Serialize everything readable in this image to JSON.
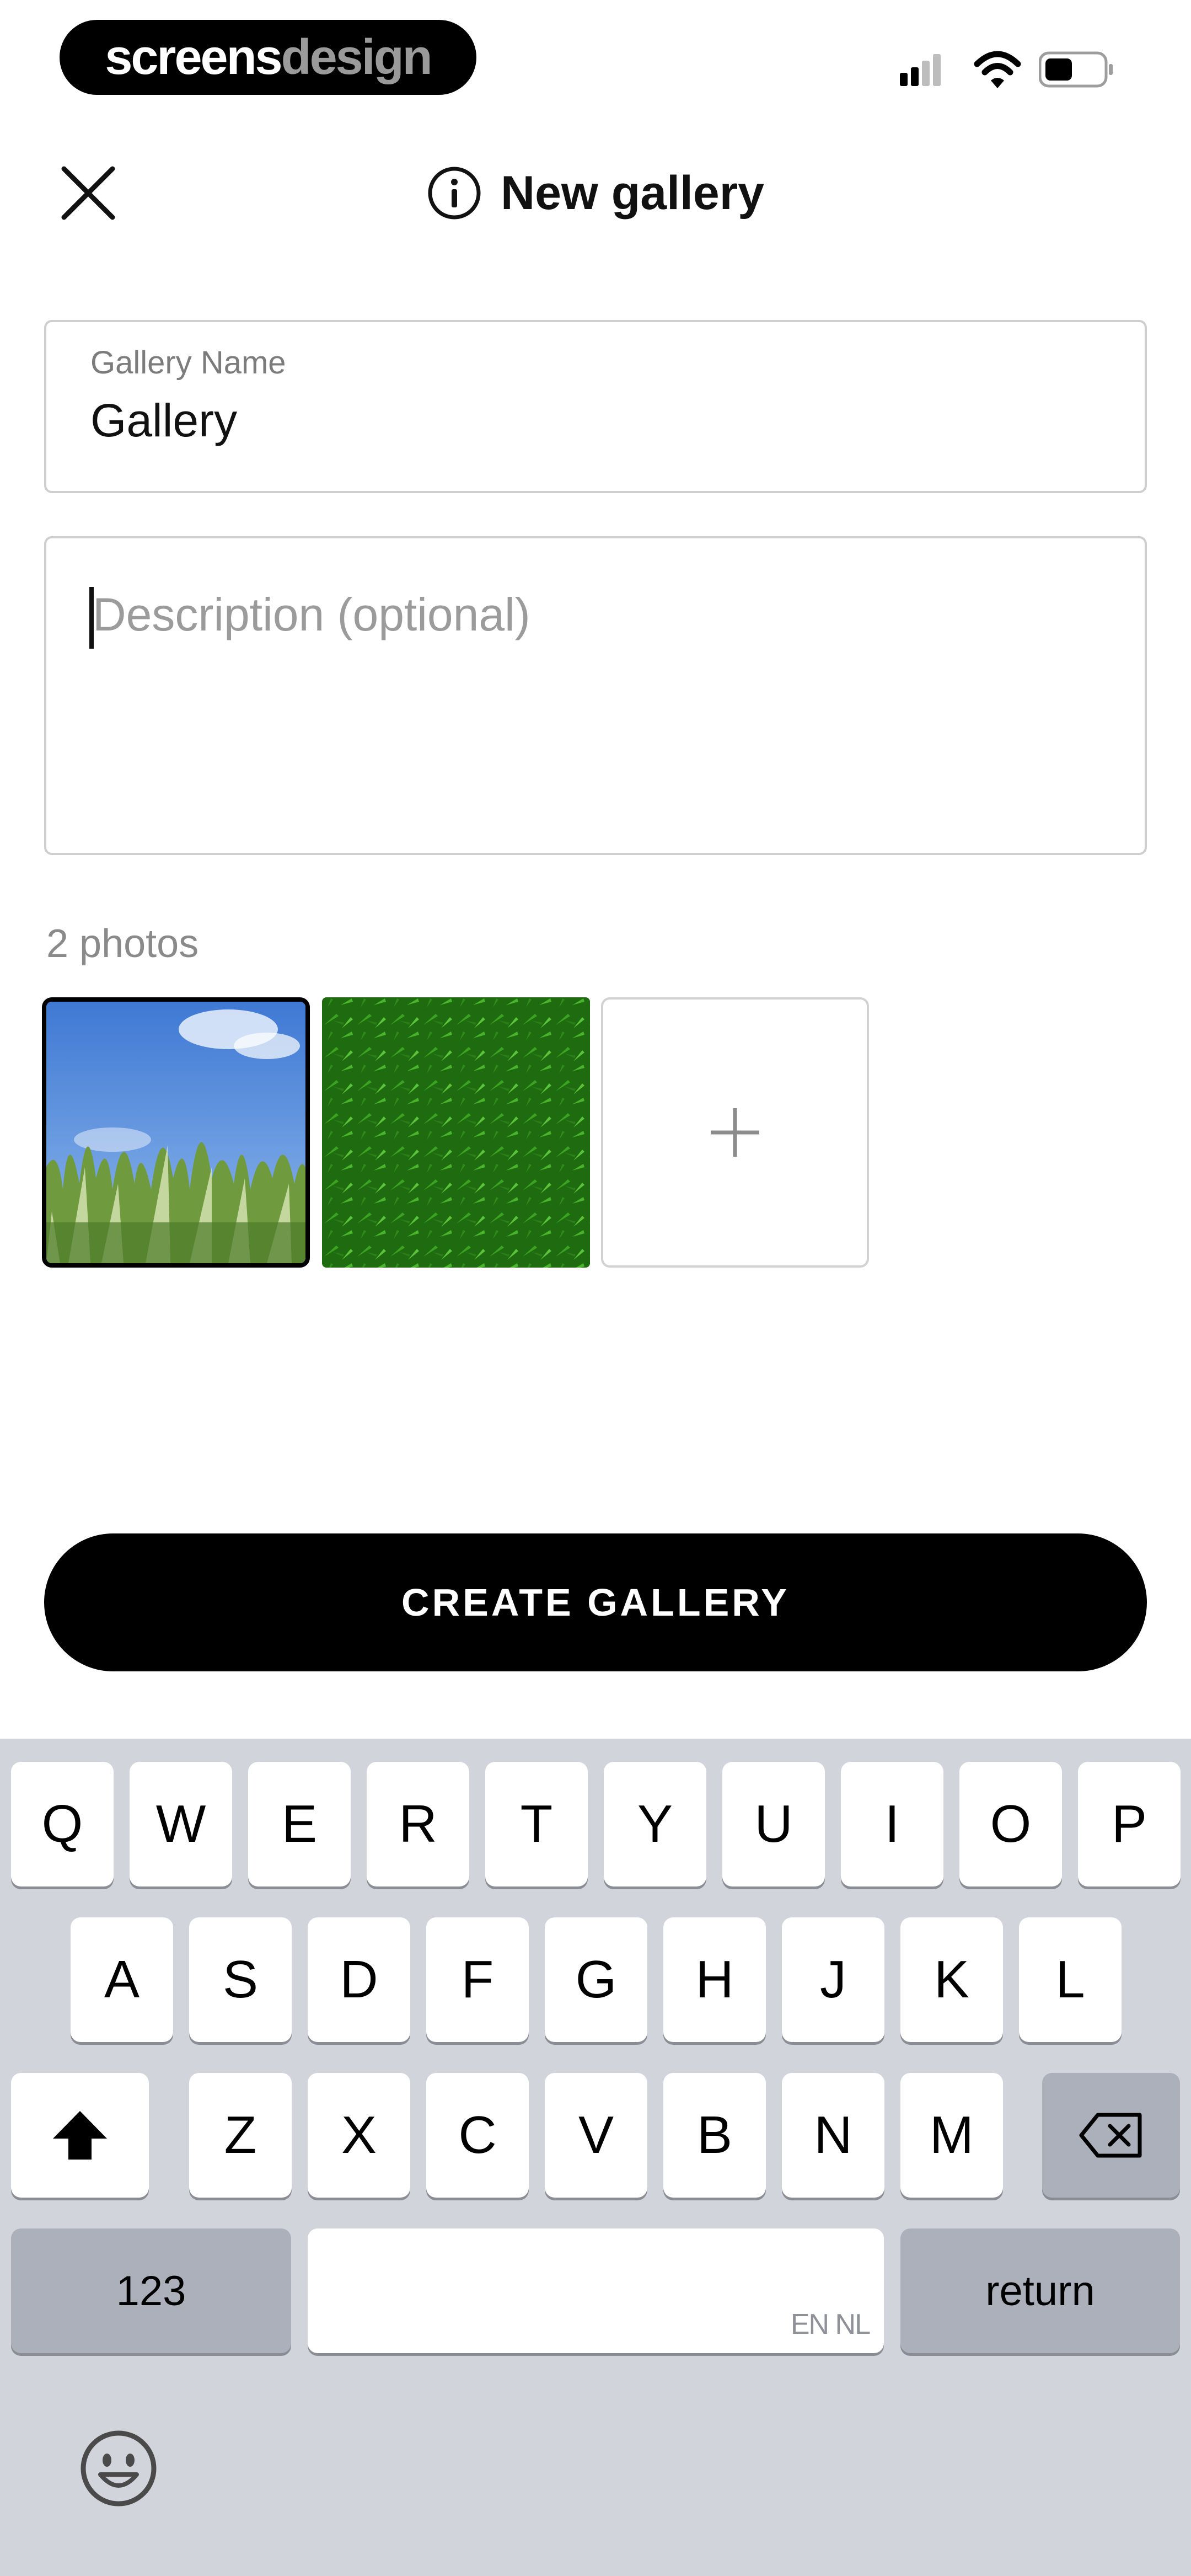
{
  "brand": {
    "part1": "screens",
    "part2": "design"
  },
  "header": {
    "title": "New gallery"
  },
  "form": {
    "name_label": "Gallery Name",
    "name_value": "Gallery",
    "description_placeholder": "Description (optional)"
  },
  "photos": {
    "count_label": "2 photos",
    "items": [
      {
        "desc": "grass and blue sky photo",
        "selected": true
      },
      {
        "desc": "green grass texture photo",
        "selected": false
      }
    ],
    "add_icon": "plus-icon"
  },
  "actions": {
    "create_label": "CREATE GALLERY"
  },
  "keyboard": {
    "row1": [
      "Q",
      "W",
      "E",
      "R",
      "T",
      "Y",
      "U",
      "I",
      "O",
      "P"
    ],
    "row2": [
      "A",
      "S",
      "D",
      "F",
      "G",
      "H",
      "J",
      "K",
      "L"
    ],
    "row3": [
      "Z",
      "X",
      "C",
      "V",
      "B",
      "N",
      "M"
    ],
    "numbers_label": "123",
    "return_label": "return",
    "space_lang": "EN NL"
  },
  "colors": {
    "accent": "#000000",
    "keyboard_bg": "#d1d4da",
    "border": "#cfcfcf"
  }
}
